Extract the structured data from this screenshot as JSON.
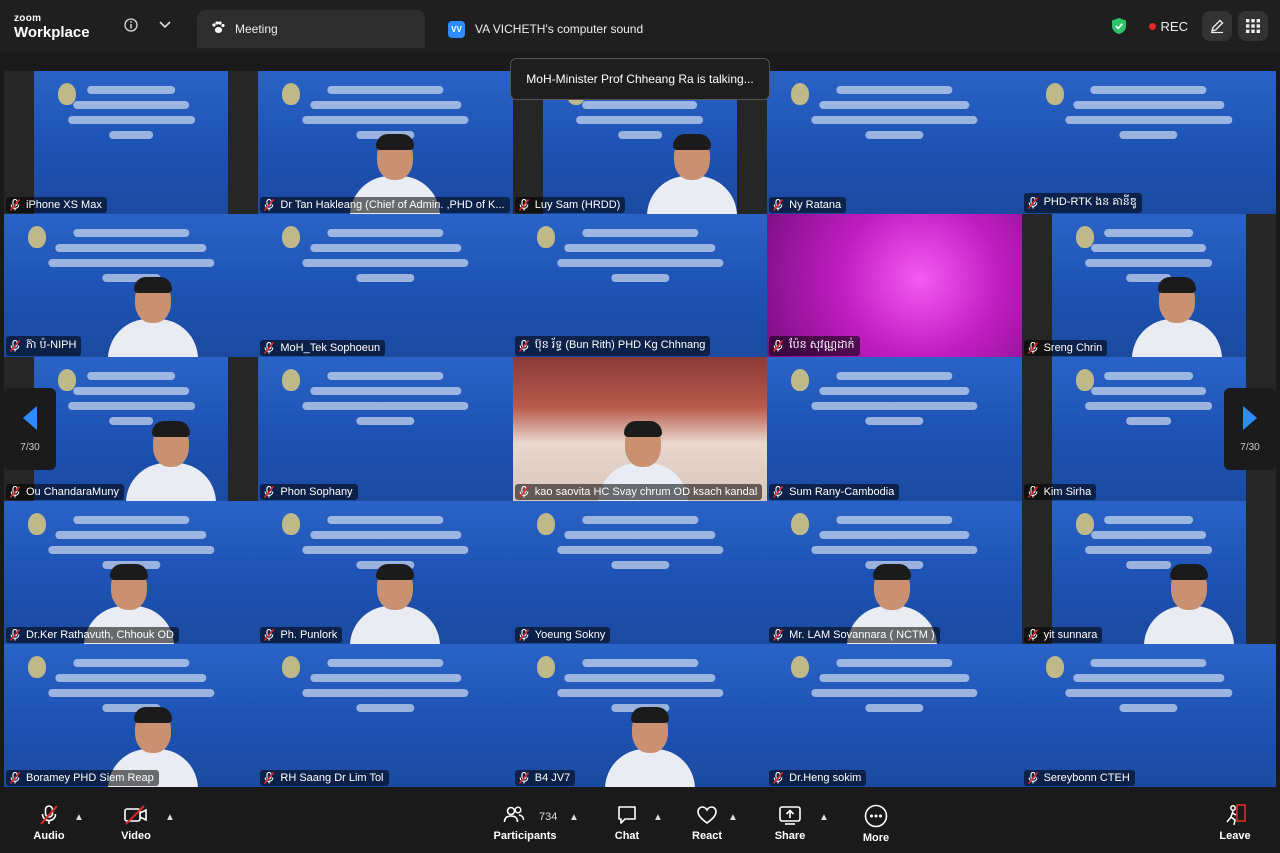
{
  "app": {
    "brand_small": "zoom",
    "brand_large": "Workplace"
  },
  "tabs": [
    {
      "label": "Meeting",
      "icon": "paw-icon"
    },
    {
      "label": "VA VICHETH's computer sound",
      "badge": "VV"
    }
  ],
  "recording": {
    "label": "REC",
    "color": "#e02828"
  },
  "speaking_toast": "MoH-Minister Prof Chheang Ra is talking...",
  "pagination": {
    "left": "7/30",
    "right": "7/30"
  },
  "participants": [
    {
      "name": "iPhone XS Max",
      "video": "slide-pillar"
    },
    {
      "name": "Dr Tan Hakleang (Chief of Admin. ,PHD of  K...",
      "video": "slide-person"
    },
    {
      "name": "Luy Sam (HRDD)",
      "video": "slide-person-pillar"
    },
    {
      "name": "Ny Ratana",
      "video": "slide"
    },
    {
      "name": "PHD-RTK ងន គានីឌូ",
      "video": "slide"
    },
    {
      "name": "ភ៊ា ប៉-NIPH",
      "video": "slide-person"
    },
    {
      "name": "MoH_Tek Sophoeun",
      "video": "slide"
    },
    {
      "name": "ប៊ុន រ័ទ្ធ (Bun Rith) PHD Kg Chhnang",
      "video": "slide"
    },
    {
      "name": "ប៉ែន សុវណ្ណដាក់",
      "video": "pink"
    },
    {
      "name": "Sreng Chrin",
      "video": "slide-person-pillar"
    },
    {
      "name": "Ou ChandaraMuny",
      "video": "slide-person-pillar"
    },
    {
      "name": "Phon Sophany",
      "video": "slide"
    },
    {
      "name": "kao saovita HC Svay chrum OD ksach kandal",
      "video": "room"
    },
    {
      "name": "Sum Rany-Cambodia",
      "video": "slide"
    },
    {
      "name": "Kim Sirha",
      "video": "slide-pillar"
    },
    {
      "name": "Dr.Ker Rathavuth, Chhouk OD",
      "video": "slide-person"
    },
    {
      "name": "Ph. Punlork",
      "video": "slide-person"
    },
    {
      "name": "Yoeung Sokny",
      "video": "slide"
    },
    {
      "name": "Mr. LAM Sovannara ( NCTM )",
      "video": "slide-person"
    },
    {
      "name": "yit sunnara",
      "video": "slide-person-pillar"
    },
    {
      "name": "Boramey PHD Siem Reap",
      "video": "slide-person"
    },
    {
      "name": "RH Saang Dr Lim Tol",
      "video": "slide"
    },
    {
      "name": "B4 JV7",
      "video": "slide-person"
    },
    {
      "name": "Dr.Heng sokim",
      "video": "slide"
    },
    {
      "name": "Sereybonn CTEH",
      "video": "slide"
    }
  ],
  "toolbar": {
    "audio": "Audio",
    "video": "Video",
    "participants": "Participants",
    "participants_count": "734",
    "chat": "Chat",
    "react": "React",
    "share": "Share",
    "more": "More",
    "leave": "Leave"
  },
  "colors": {
    "accent": "#2d8cff",
    "leave": "#e02828",
    "shield": "#2cc36b"
  }
}
